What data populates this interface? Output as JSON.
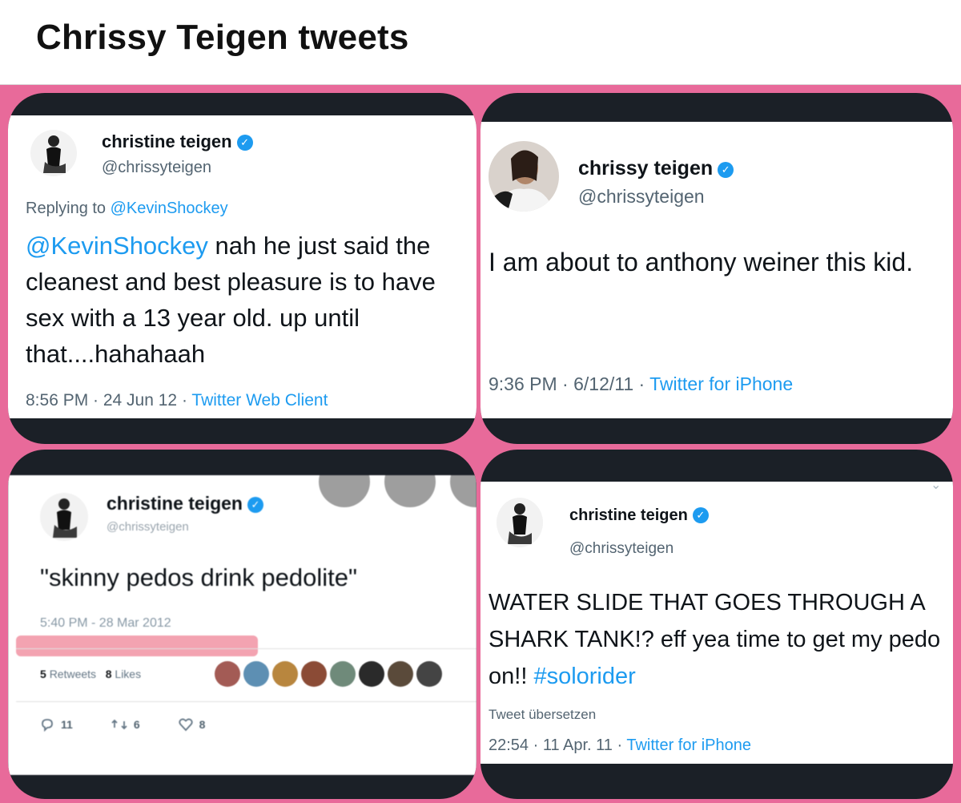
{
  "page_title": "Chrissy Teigen tweets",
  "colors": {
    "background": "#e86a9a",
    "card_frame": "#1b2027",
    "link": "#1d9bf0"
  },
  "tweets": [
    {
      "name": "christine teigen",
      "handle": "@chrissyteigen",
      "replying_prefix": "Replying to",
      "replying_to": "@KevinShockey",
      "mention": "@KevinShockey",
      "text": " nah he just said the cleanest and best pleasure is to have sex with a 13 year old. up until that....hahahaah",
      "time": "8:56 PM · 24 Jun 12 · ",
      "source": "Twitter Web Client"
    },
    {
      "name": "chrissy teigen",
      "handle": "@chrissyteigen",
      "text": "I am about to anthony weiner this kid.",
      "time": "9:36 PM · 6/12/11 · ",
      "source": "Twitter for iPhone"
    },
    {
      "name": "christine teigen",
      "handle": "@chrissyteigen",
      "text": "\"skinny pedos drink pedolite\"",
      "time": "5:40 PM - 28 Mar 2012",
      "retweets_count": "5",
      "retweets_label": "Retweets",
      "likes_count": "8",
      "likes_label": "Likes",
      "reply_count": "11",
      "retweet_action_count": "6",
      "like_action_count": "8"
    },
    {
      "name": "christine teigen",
      "handle": "@chrissyteigen",
      "text": "WATER SLIDE THAT GOES THROUGH A SHARK TANK!? eff yea time to get my pedo on!! ",
      "hashtag": "#solorider",
      "translate": "Tweet übersetzen",
      "time": "22:54 · 11 Apr. 11 · ",
      "source": "Twitter for iPhone"
    }
  ]
}
